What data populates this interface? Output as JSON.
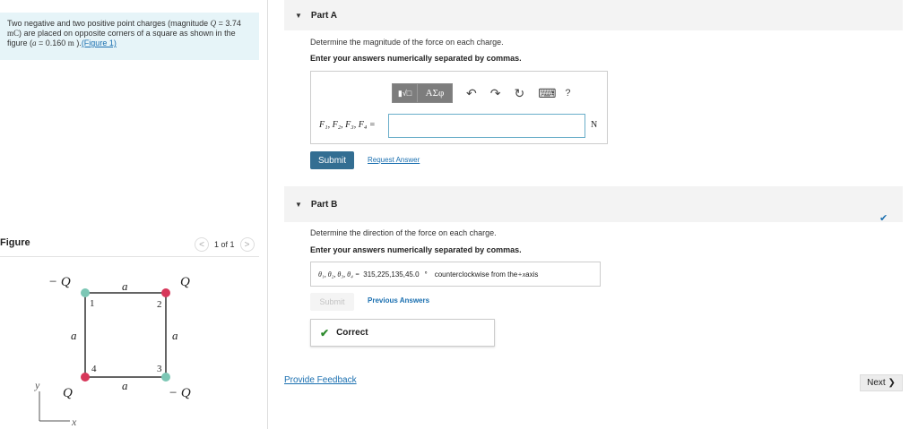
{
  "prompt": {
    "text_1": "Two negative and two positive point charges (magnitude ",
    "q_symbol": "Q",
    "text_2": " = 3.74",
    "unit_mc": "mC",
    "text_3": ") are placed on opposite corners of a square as shown in the figure (",
    "a_symbol": "a",
    "text_4": " = 0.160 ",
    "unit_m": "m",
    "text_5": " ).",
    "figure_link": "(Figure 1)"
  },
  "figure": {
    "title": "Figure",
    "counter": "1 of 1",
    "prev_glyph": "<",
    "next_glyph": ">",
    "labels": {
      "neg_q_top": "− Q",
      "pos_q_top": "Q",
      "pos_q_bottom": "Q",
      "neg_q_bottom": "− Q",
      "side_top": "a",
      "side_left": "a",
      "side_right": "a",
      "side_bottom": "a",
      "corner_1": "1",
      "corner_2": "2",
      "corner_3": "3",
      "corner_4": "4",
      "axis_y": "y",
      "axis_x": "x"
    },
    "colors": {
      "positive": "#d7375a",
      "negative": "#7cc7b5"
    }
  },
  "part_a": {
    "title": "Part A",
    "question": "Determine the magnitude of the force on each charge.",
    "instruction": "Enter your answers numerically separated by commas.",
    "toolbar": {
      "templates_label": "▮√□",
      "symbols_label": "ΑΣφ",
      "undo_icon": "↶",
      "redo_icon": "↷",
      "reset_icon": "↻",
      "keyboard_icon": "⌨",
      "help_label": "?"
    },
    "equation_label": "F₁, F₂, F₃, F₄ =",
    "input_value": "",
    "unit": "N",
    "submit_label": "Submit",
    "request_answer_label": "Request Answer"
  },
  "part_b": {
    "title": "Part B",
    "question": "Determine the direction of the force on each charge.",
    "instruction": "Enter your answers numerically separated by commas.",
    "answer_label": "θ₁, θ₂, θ₃, θ₄ =",
    "answer_value": "315,225,135,45.0",
    "degree": "°",
    "answer_suffix_1": "counterclockwise from the ",
    "answer_axis": "+x",
    "answer_suffix_2": " axis",
    "submit_label": "Submit",
    "previous_answers_label": "Previous Answers",
    "correct_label": "Correct"
  },
  "footer": {
    "feedback_label": "Provide Feedback",
    "next_label": "Next ❯"
  }
}
